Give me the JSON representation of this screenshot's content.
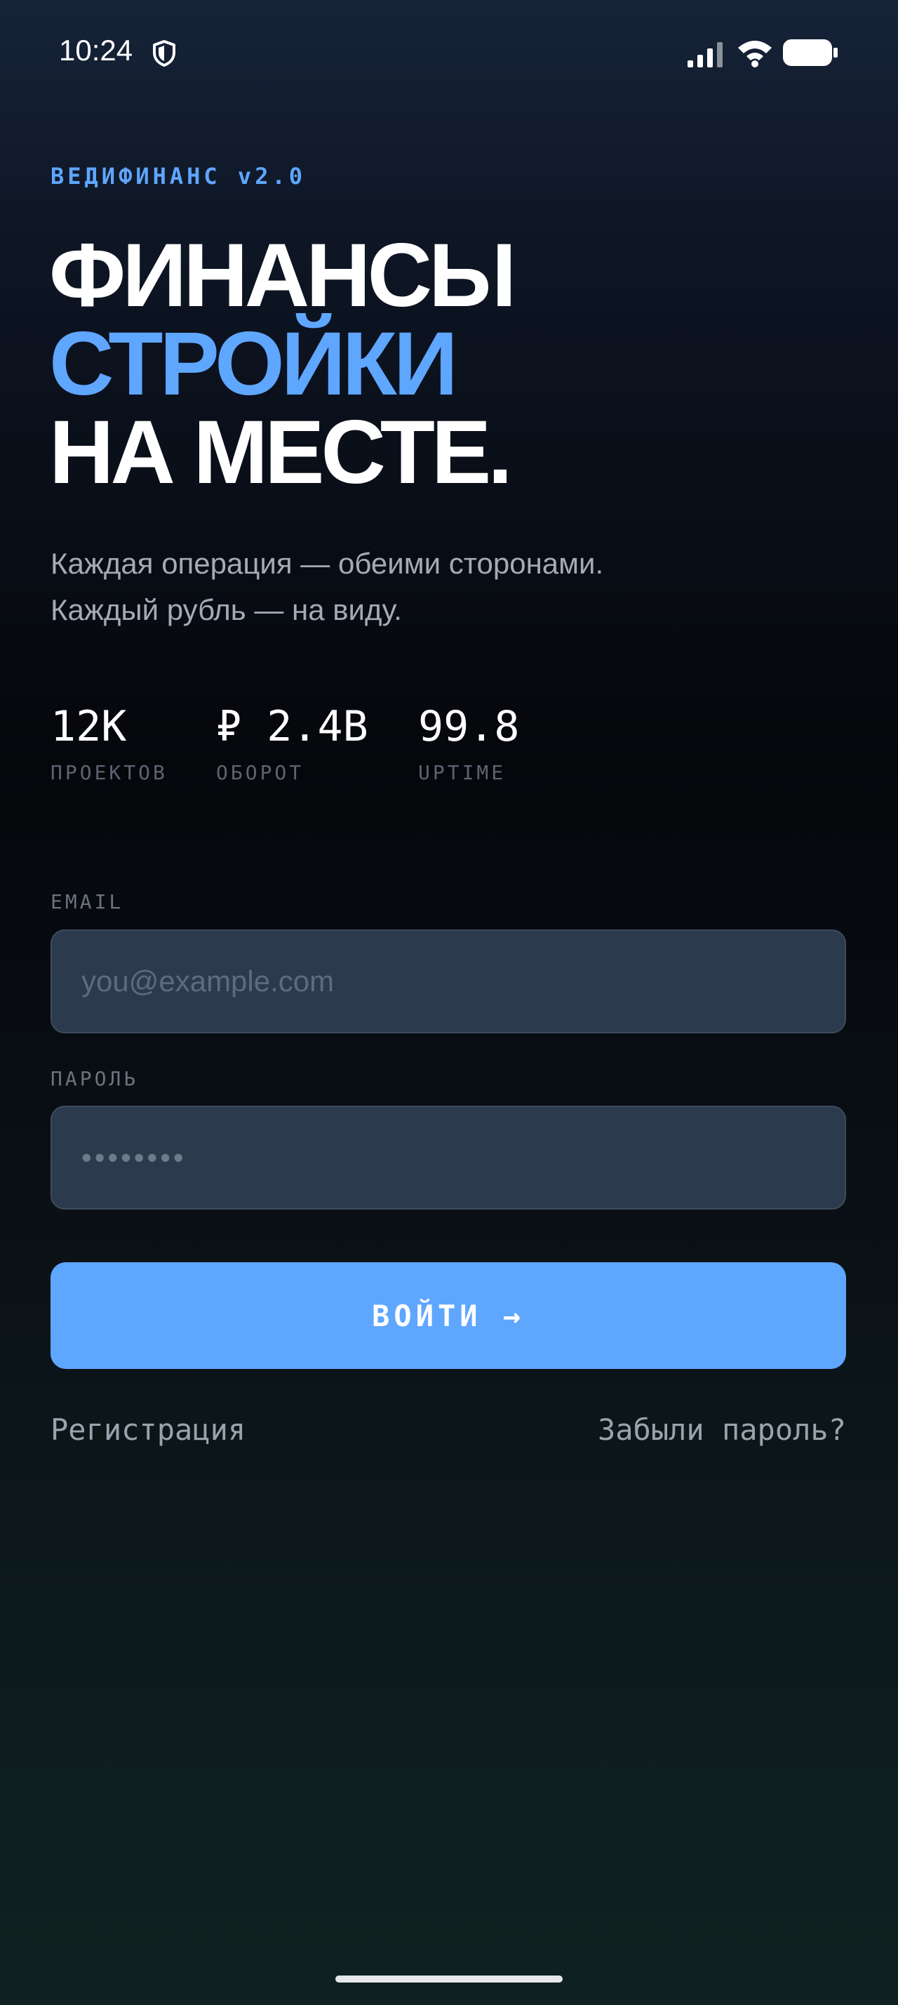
{
  "status_bar": {
    "time": "10:24",
    "icons": [
      "shield-icon",
      "cellular-signal-icon",
      "wifi-icon",
      "battery-icon"
    ]
  },
  "brand": "ВЕДИФИНАНС v2.0",
  "hero": {
    "line1": "ФИНАНСЫ",
    "line2": "СТРОЙКИ",
    "line3": "НА МЕСТЕ."
  },
  "tagline": {
    "line1": "Каждая операция — обеими сторонами.",
    "line2": "Каждый рубль — на виду."
  },
  "stats": [
    {
      "value": "12K",
      "label": "ПРОЕКТОВ"
    },
    {
      "value": "₽ 2.4B",
      "label": "ОБОРОТ"
    },
    {
      "value": "99.8",
      "label": "UPTIME"
    }
  ],
  "form": {
    "email_label": "EMAIL",
    "email_placeholder": "you@example.com",
    "password_label": "ПАРОЛЬ",
    "password_placeholder": "••••••••",
    "submit_label": "ВОЙТИ",
    "submit_arrow": "→"
  },
  "links": {
    "register": "Регистрация",
    "forgot": "Забыли пароль?"
  },
  "colors": {
    "accent": "#5fa6ff",
    "text_primary": "#ffffff",
    "text_muted": "#a3abb6",
    "input_bg": "#2c3a4e"
  }
}
